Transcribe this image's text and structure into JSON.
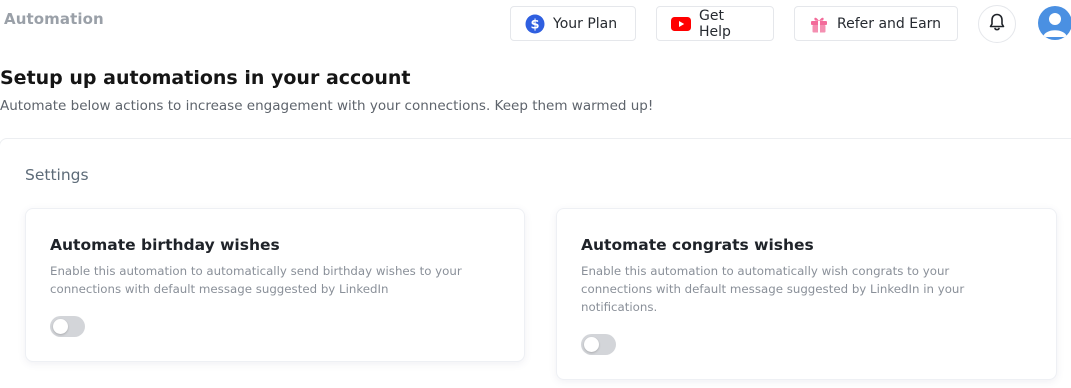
{
  "header": {
    "breadcrumb": "Automation",
    "buttons": {
      "your_plan": "Your Plan",
      "get_help": "Get Help",
      "refer_and_earn": "Refer and Earn"
    },
    "icons": {
      "plan": "dollar-circle-icon",
      "help": "youtube-play-icon",
      "refer": "gift-icon",
      "notifications": "bell-icon",
      "profile": "user-avatar-icon"
    },
    "colors": {
      "plan_icon": "#2f5fe0",
      "help_icon": "#ff0000",
      "refer_icon": "#f36b9a",
      "avatar": "#4a90e2"
    }
  },
  "main": {
    "title": "Setup up automations in your account",
    "subtitle": "Automate below actions to increase engagement with your connections. Keep them warmed up!",
    "settings": {
      "heading": "Settings",
      "cards": [
        {
          "title": "Automate birthday wishes",
          "description": "Enable this automation to automatically send birthday wishes to your connections with default message suggested by LinkedIn",
          "enabled": false
        },
        {
          "title": "Automate congrats wishes",
          "description": "Enable this automation to automatically wish congrats to your connections with default message suggested by LinkedIn in your notifications.",
          "enabled": false
        }
      ]
    }
  }
}
